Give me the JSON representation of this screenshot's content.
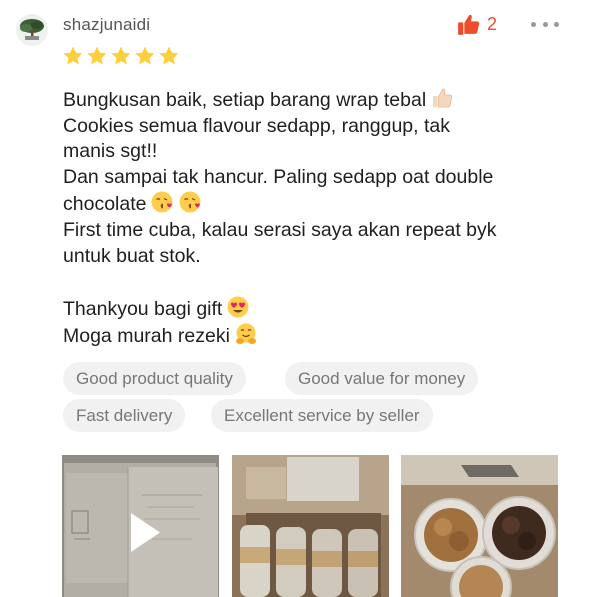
{
  "review": {
    "username": "shazjunaidi",
    "like_count": "2",
    "rating": 5,
    "lines": [
      "Bungkusan baik, setiap barang wrap tebal",
      "Cookies semua flavour sedapp, ranggup, tak",
      "manis sgt!!",
      "Dan sampai tak hancur. Paling sedapp oat double",
      "chocolate",
      "First time cuba, kalau serasi saya akan repeat byk",
      "untuk buat stok.",
      "",
      "Thankyou bagi gift",
      "Moga murah rezeki"
    ],
    "tags": [
      "Good product quality",
      "Good value for money",
      "Fast delivery",
      "Excellent service by seller"
    ]
  },
  "icons": {
    "avatar": "bonsai-avatar",
    "like": "thumbs-up-icon",
    "more": "more-dots-icon",
    "star": "star-icon",
    "emoji": [
      "thumbs-up-emoji",
      "kiss-emoji",
      "kiss-emoji",
      "heart-eyes-emoji",
      "hug-emoji"
    ]
  },
  "colors": {
    "accent": "#ee4d2d",
    "star": "#ffce3d",
    "tag_bg": "#f1f1f1",
    "tag_text": "#777777"
  }
}
